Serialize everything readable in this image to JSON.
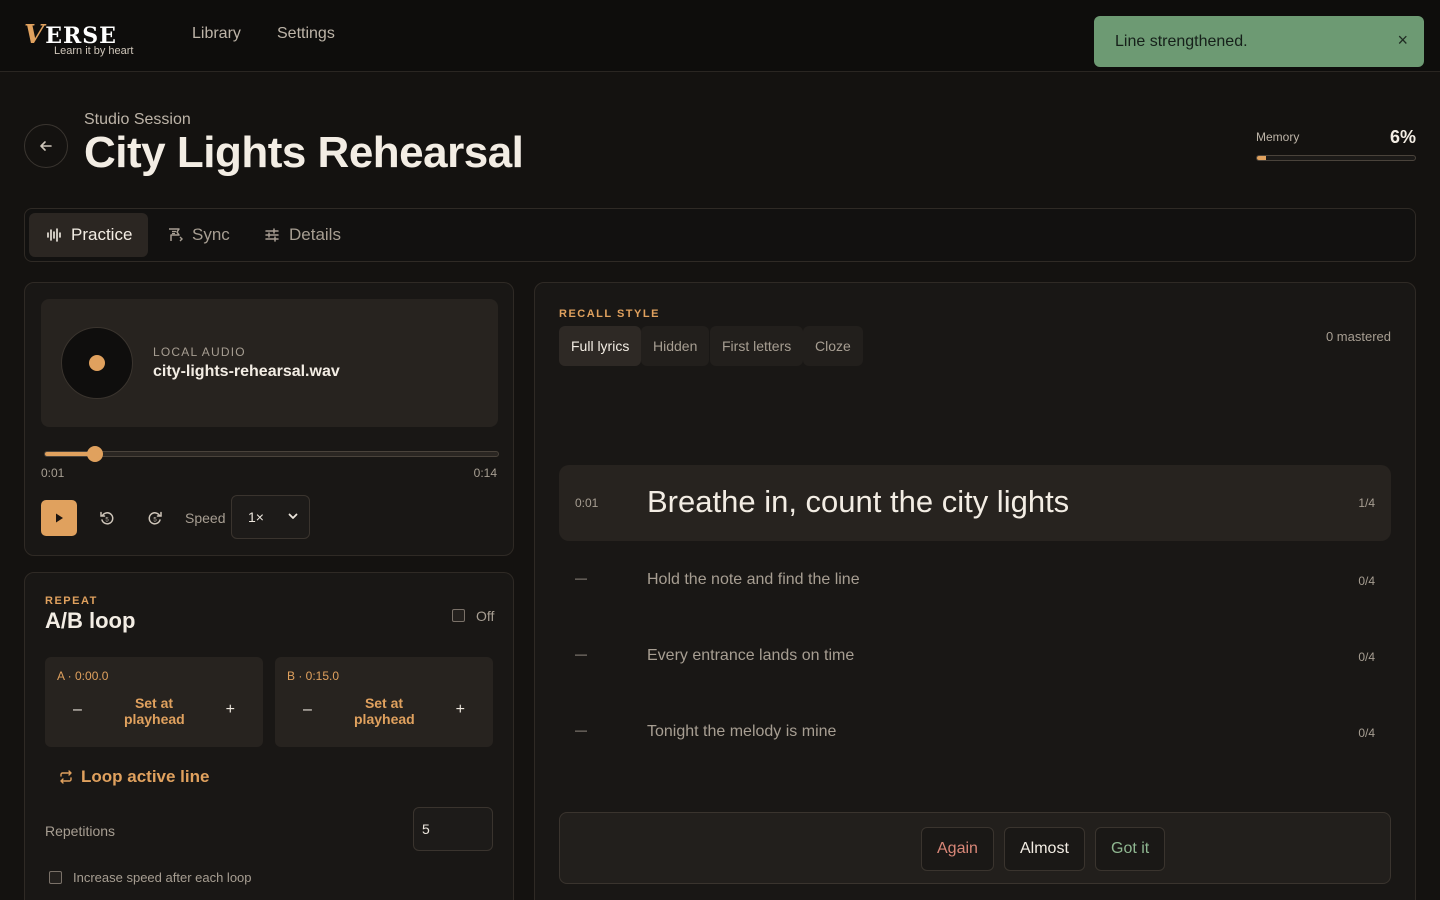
{
  "app": {
    "brand": "VERSE",
    "tagline": "Learn it by heart",
    "nav": [
      "Library",
      "Settings"
    ]
  },
  "toast": {
    "message": "Line strengthened.",
    "close": "×"
  },
  "header": {
    "eyebrow": "Studio Session",
    "title": "City Lights Rehearsal",
    "memory_label": "Memory",
    "memory_value": "6%",
    "memory_fraction": 0.06
  },
  "tabs": [
    {
      "label": "Practice",
      "icon": "waveform-icon",
      "active": true
    },
    {
      "label": "Sync",
      "icon": "sync-flag-icon",
      "active": false
    },
    {
      "label": "Details",
      "icon": "sliders-icon",
      "active": false
    }
  ],
  "player": {
    "source_label": "LOCAL AUDIO",
    "file_name": "city-lights-rehearsal.wav",
    "current_time": "0:01",
    "total_time": "0:14",
    "progress_fraction": 0.11,
    "speed_label": "Speed",
    "speed_value": "1×"
  },
  "loop": {
    "eyebrow": "REPEAT",
    "title": "A/B loop",
    "toggle_label": "Off",
    "a_label": "A · 0:00.0",
    "b_label": "B · 0:15.0",
    "minus": "–",
    "plus": "+",
    "set_label": "Set at playhead",
    "loop_line_label": "Loop active line",
    "repetitions_label": "Repetitions",
    "repetitions_value": "5",
    "increase_label": "Increase speed after each loop"
  },
  "recall": {
    "eyebrow": "RECALL STYLE",
    "modes": [
      "Full lyrics",
      "Hidden",
      "First letters",
      "Cloze"
    ],
    "mastered": "0 mastered",
    "lines": [
      {
        "time": "0:01",
        "text": "Breathe in, count the city lights",
        "count": "1/4",
        "active": true
      },
      {
        "time": "—",
        "text": "Hold the note and find the line",
        "count": "0/4",
        "active": false
      },
      {
        "time": "—",
        "text": "Every entrance lands on time",
        "count": "0/4",
        "active": false
      },
      {
        "time": "—",
        "text": "Tonight the melody is mine",
        "count": "0/4",
        "active": false
      }
    ],
    "grades": [
      "Again",
      "Almost",
      "Got it"
    ]
  },
  "colors": {
    "accent": "#e0a15e",
    "toast_bg": "#6d9a73",
    "again": "#d98778",
    "got_it": "#8fb791"
  }
}
